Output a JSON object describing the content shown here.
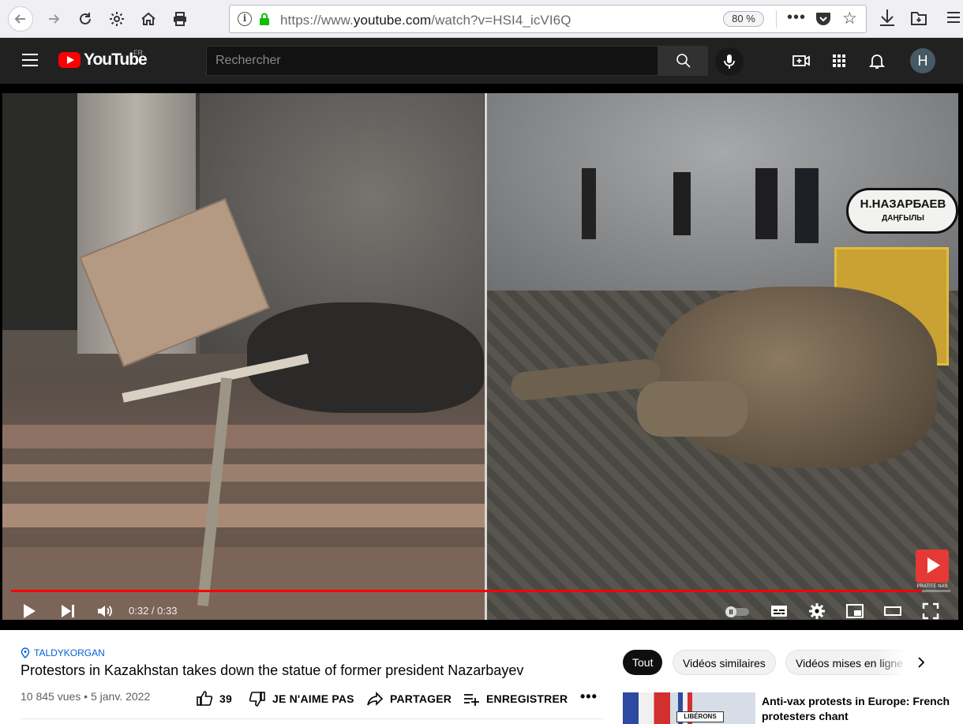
{
  "browser": {
    "url_prefix": "https://www.",
    "url_domain": "youtube.com",
    "url_suffix": "/watch?v=HSI4_icVI6Q",
    "zoom": "80 %",
    "more_label": "•••"
  },
  "header": {
    "wordmark": "YouTube",
    "country": "FR",
    "search_placeholder": "Rechercher",
    "avatar_letter": "H"
  },
  "player": {
    "time": "0:32 / 0:33",
    "progress": 0.97,
    "sign_line1": "Н.НАЗАРБАЕВ",
    "sign_line2": "ДАҢҒЫЛЫ",
    "watermark_label": "PRATITE NAS"
  },
  "video": {
    "location": "TALDYKORGAN",
    "title": "Protestors in Kazakhstan takes down the statue of former president Nazarbayev",
    "views": "10 845 vues",
    "date": "5 janv. 2022",
    "likes": "39",
    "dislike_label": "JE N'AIME PAS",
    "share_label": "PARTAGER",
    "save_label": "ENREGISTRER",
    "more_label": "•••"
  },
  "chips": [
    {
      "label": "Tout"
    },
    {
      "label": "Vidéos similaires"
    },
    {
      "label": "Vidéos mises en ligne par"
    }
  ],
  "recommendation": {
    "title": "Anti-vax protests in Europe: French protesters chant",
    "thumb_text": "LIBÉRONS"
  },
  "colors": {
    "accent": "#ff0000",
    "header_bg": "#212121",
    "link": "#065fd4"
  }
}
